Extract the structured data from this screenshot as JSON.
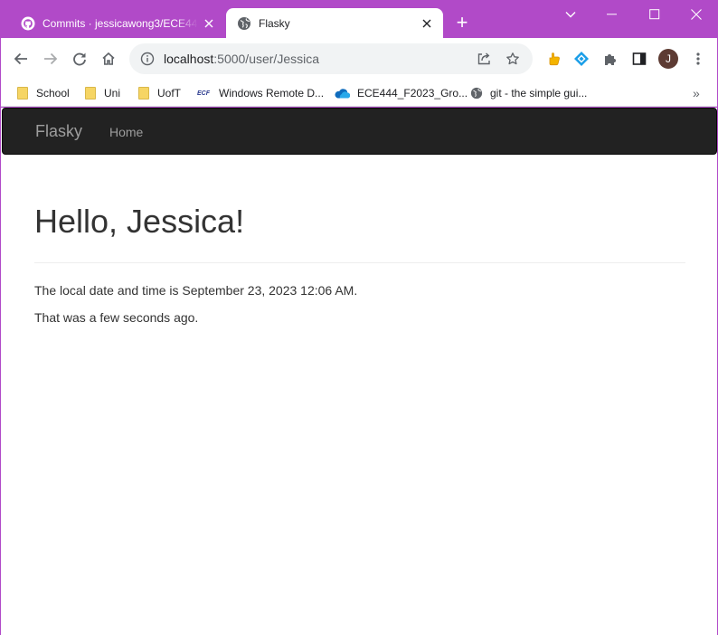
{
  "browser": {
    "tabs": [
      {
        "title": "Commits · jessicawong3/ECE444-",
        "favicon": "github-icon",
        "active": false
      },
      {
        "title": "Flasky",
        "favicon": "globe-icon",
        "active": true
      }
    ],
    "new_tab_label": "+",
    "address": {
      "host": "localhost",
      "rest": ":5000/user/Jessica"
    },
    "bookmarks": [
      {
        "label": "School",
        "icon": "folder-icon"
      },
      {
        "label": "Uni",
        "icon": "folder-icon"
      },
      {
        "label": "UofT",
        "icon": "folder-icon"
      },
      {
        "label": "Windows Remote D...",
        "icon": "ecf-icon",
        "icon_text": "ECF"
      },
      {
        "label": "ECE444_F2023_Gro...",
        "icon": "onedrive-icon"
      },
      {
        "label": "git - the simple gui...",
        "icon": "globe-icon"
      }
    ],
    "bookmarks_overflow": "»",
    "profile_initial": "J",
    "colors": {
      "frame": "#b14ac8",
      "profile": "#5d3b33"
    }
  },
  "page": {
    "navbar": {
      "brand": "Flasky",
      "links": [
        {
          "label": "Home"
        }
      ]
    },
    "heading": "Hello, Jessica!",
    "datetime_text": "The local date and time is September 23, 2023 12:06 AM.",
    "relative_text": "That was a few seconds ago."
  }
}
